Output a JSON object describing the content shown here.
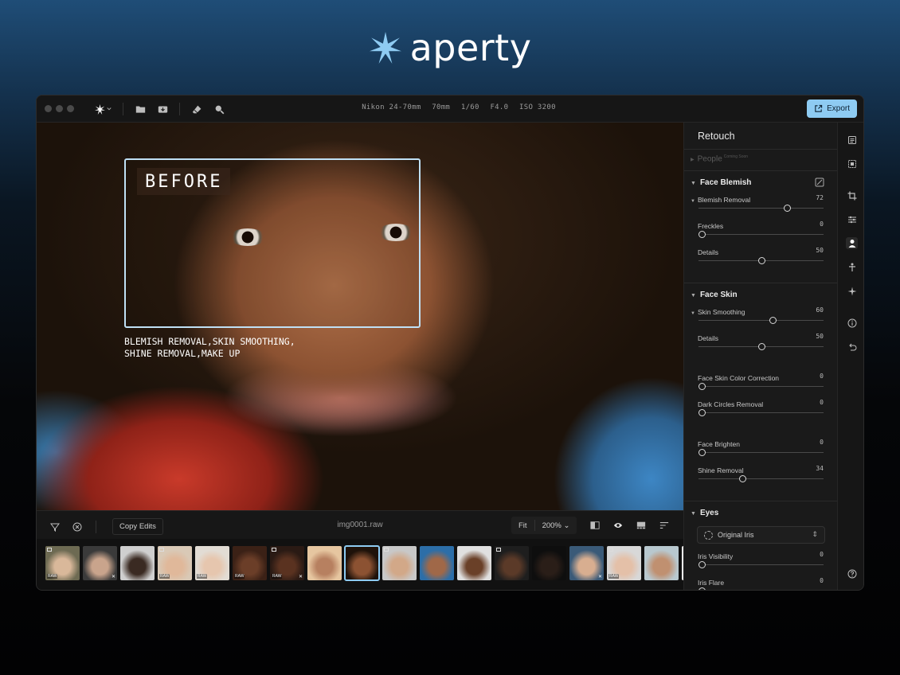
{
  "brand": {
    "name": "aperty",
    "star_color": "#8ecbf2"
  },
  "titlebar": {
    "camera_meta": [
      "Nikon 24-70mm",
      "70mm",
      "1/60",
      "F4.0",
      "ISO 3200"
    ],
    "export_label": "Export",
    "accent": "#8ecbf2"
  },
  "photo": {
    "before_label": "BEFORE",
    "caption_line1": "BLEMISH REMOVAL,SKIN SMOOTHING,",
    "caption_line2": "SHINE REMOVAL,MAKE UP"
  },
  "bottombar": {
    "copy_edits": "Copy Edits",
    "filename": "img0001.raw",
    "fit": "Fit",
    "zoom": "200%"
  },
  "filmstrip": [
    {
      "bg": "#6d6a52",
      "face": "#d9b89a",
      "raw": true
    },
    {
      "bg": "#3a3a3a",
      "face": "#c9a48c",
      "x": true
    },
    {
      "bg": "#cfcfcf",
      "face": "#3a2a22",
      "raw": false
    },
    {
      "bg": "#d9c9b6",
      "face": "#e0b89a",
      "raw": true
    },
    {
      "bg": "#e2dcd4",
      "face": "#e6c6ae",
      "raw": true
    },
    {
      "bg": "#3b2116",
      "face": "#6b3e28",
      "raw": true
    },
    {
      "bg": "#2a1a14",
      "face": "#5a3220",
      "raw": true,
      "x": true
    },
    {
      "bg": "#e6c6a0",
      "face": "#b78060",
      "raw": false
    },
    {
      "bg": "#1e120a",
      "face": "#8c5232",
      "selected": true
    },
    {
      "bg": "#c8c8c8",
      "face": "#d2a888",
      "raw": false
    },
    {
      "bg": "#2c6ea8",
      "face": "#a06848",
      "raw": false
    },
    {
      "bg": "#e0e0e0",
      "face": "#6a4028",
      "raw": false
    },
    {
      "bg": "#1e1e1e",
      "face": "#5b3a28",
      "raw": false
    },
    {
      "bg": "#0e0e0e",
      "face": "#2a1e18",
      "raw": false
    },
    {
      "bg": "#3a5a78",
      "face": "#d8ae90",
      "x": true
    },
    {
      "bg": "#d8d8d8",
      "face": "#e4c0a8",
      "raw": true
    },
    {
      "bg": "#b8c8cf",
      "face": "#c09070",
      "raw": false
    },
    {
      "bg": "#f0f0f0",
      "face": "#aaaaaa",
      "raw": false
    }
  ],
  "panel": {
    "title": "Retouch",
    "people_label": "People",
    "people_badge": "Coming Soon",
    "face_blemish": {
      "title": "Face Blemish",
      "sliders": [
        {
          "label": "Blemish Removal",
          "value": "72",
          "level": 0.72,
          "expandable": true
        },
        {
          "label": "Freckles",
          "value": "0",
          "level": 0.0
        },
        {
          "label": "Details",
          "value": "50",
          "level": 0.5
        }
      ]
    },
    "face_skin": {
      "title": "Face Skin",
      "sliders": [
        {
          "label": "Skin Smoothing",
          "value": "60",
          "level": 0.6,
          "expandable": true
        },
        {
          "label": "Details",
          "value": "50",
          "level": 0.5
        },
        {
          "label": "Face Skin Color Correction",
          "value": "0",
          "level": 0.0
        },
        {
          "label": "Dark Circles Removal",
          "value": "0",
          "level": 0.0
        },
        {
          "label": "Face Brighten",
          "value": "0",
          "level": 0.0
        },
        {
          "label": "Shine Removal",
          "value": "34",
          "level": 0.34
        }
      ]
    },
    "eyes": {
      "title": "Eyes",
      "select_value": "Original Iris",
      "sliders": [
        {
          "label": "Iris Visibility",
          "value": "0",
          "level": 0.0
        },
        {
          "label": "Iris Flare",
          "value": "0",
          "level": 0.0
        }
      ]
    }
  },
  "rail_icons": [
    "layers-icon",
    "select-icon",
    "crop-icon",
    "adjust-icon",
    "person-icon",
    "body-icon",
    "sparkle-icon",
    "info-icon",
    "undo-icon",
    "help-icon"
  ]
}
